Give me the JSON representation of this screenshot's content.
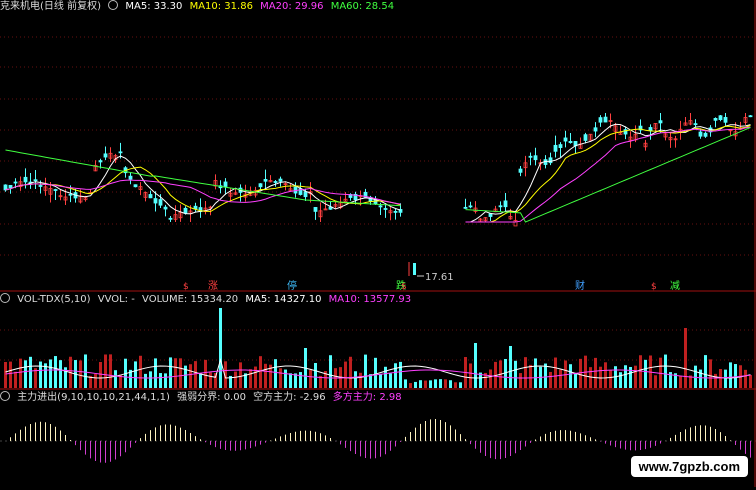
{
  "price_header": {
    "name": "克来机电(日线 前复权)",
    "ma5": "MA5: 33.30",
    "ma10": "MA10: 31.86",
    "ma20": "MA20: 29.96",
    "ma60": "MA60: 28.54"
  },
  "vol_header": {
    "name": "VOL-TDX(5,10)",
    "vvol": "VVOL: -",
    "volume": "VOLUME: 15334.20",
    "ma5": "MA5: 14327.10",
    "ma10": "MA10: 13577.93"
  },
  "ind_header": {
    "name": "主力进出(9,10,10,10,21,44,1,1)",
    "strong": "强弱分界: 0.00",
    "short": "空方主力: -2.96",
    "long": "多方主力: 2.98"
  },
  "low_label": "17.61",
  "event_markers": [
    {
      "text": "涨",
      "color": "#ff4040"
    },
    {
      "text": "停",
      "color": "#40c0ff"
    },
    {
      "text": "跌",
      "color": "#40ff40"
    },
    {
      "text": "财",
      "color": "#40a0ff"
    },
    {
      "text": "减",
      "color": "#40ff40"
    }
  ],
  "small_markers": [
    "$",
    "$",
    "$"
  ],
  "watermark": "www.7gpzb.com",
  "colors": {
    "up": "#ff4040",
    "down": "#54ffff",
    "ma5": "#ffffff",
    "ma10": "#ffff00",
    "ma20": "#ff40ff",
    "ma60": "#40ff40",
    "vol_up": "#c02020",
    "vol_down": "#5ff"
  },
  "chart_data": {
    "type": "candlestick",
    "panels": [
      "price",
      "volume",
      "main-force indicator"
    ],
    "price_range": [
      17.61,
      36
    ],
    "last_ma": {
      "ma5": 33.3,
      "ma10": 31.86,
      "ma20": 29.96,
      "ma60": 28.54
    },
    "volume_last": {
      "volume": 15334.2,
      "ma5": 14327.1,
      "ma10": 13577.93
    },
    "indicator_last": {
      "strong_weak": 0.0,
      "short_force": -2.96,
      "long_force": 2.98
    },
    "period_low": 17.61
  }
}
